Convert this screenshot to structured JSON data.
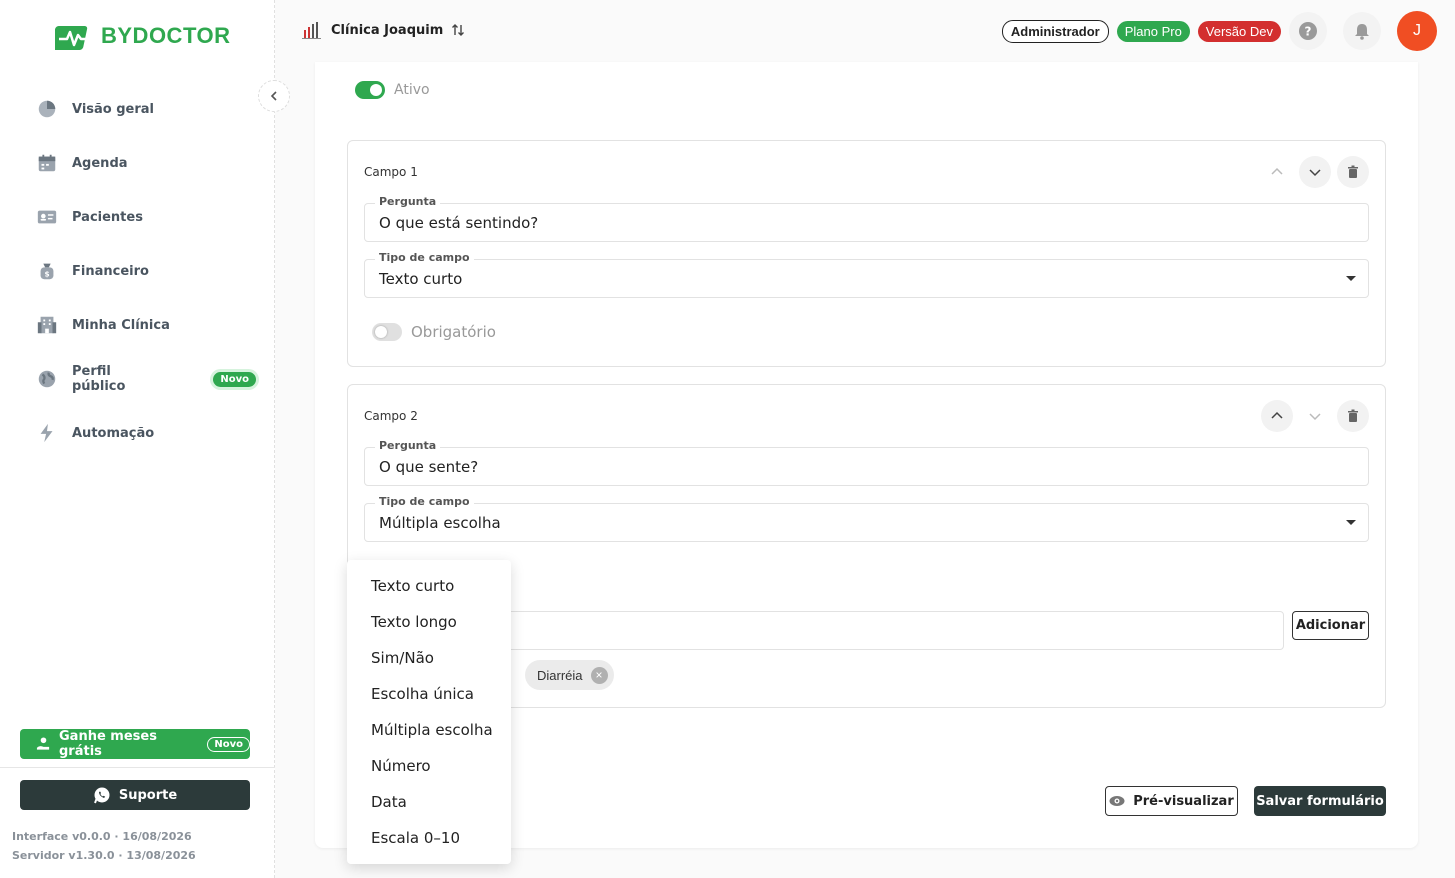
{
  "brand": {
    "name": "BYDOCTOR",
    "accent": "#2fa84f"
  },
  "sidebar": {
    "items": [
      {
        "label": "Visão geral",
        "icon": "pie-chart-icon"
      },
      {
        "label": "Agenda",
        "icon": "calendar-icon"
      },
      {
        "label": "Pacientes",
        "icon": "contact-card-icon"
      },
      {
        "label": "Financeiro",
        "icon": "money-bag-icon"
      },
      {
        "label": "Minha Clínica",
        "icon": "building-icon"
      },
      {
        "label": "Perfil público",
        "icon": "globe-icon",
        "badge": "Novo"
      },
      {
        "label": "Automação",
        "icon": "lightning-icon"
      }
    ],
    "promo": {
      "label": "Ganhe meses grátis",
      "badge": "Novo"
    },
    "support": {
      "label": "Suporte"
    },
    "version": {
      "interface": "Interface v0.0.0 · 16/08/2026",
      "server": "Servidor v1.30.0 · 13/08/2026"
    }
  },
  "header": {
    "clinic": "Clínica Joaquim",
    "chips": {
      "admin": "Administrador",
      "plan": "Plano Pro",
      "env": "Versão Dev"
    },
    "avatar": "J"
  },
  "form": {
    "active_label": "Ativo",
    "active": true,
    "fields": [
      {
        "title": "Campo 1",
        "question_label": "Pergunta",
        "question": "O que está sentindo?",
        "type_label": "Tipo de campo",
        "type": "Texto curto",
        "required_label": "Obrigatório",
        "required": false
      },
      {
        "title": "Campo 2",
        "question_label": "Pergunta",
        "question": "O que sente?",
        "type_label": "Tipo de campo",
        "type": "Múltipla escolha",
        "add_label": "Adicionar",
        "options": [
          "Diarréia"
        ]
      }
    ],
    "preview_label": "Pré-visualizar",
    "save_label": "Salvar formulário"
  },
  "type_menu": {
    "options": [
      "Texto curto",
      "Texto longo",
      "Sim/Não",
      "Escolha única",
      "Múltipla escolha",
      "Número",
      "Data",
      "Escala 0–10"
    ]
  }
}
